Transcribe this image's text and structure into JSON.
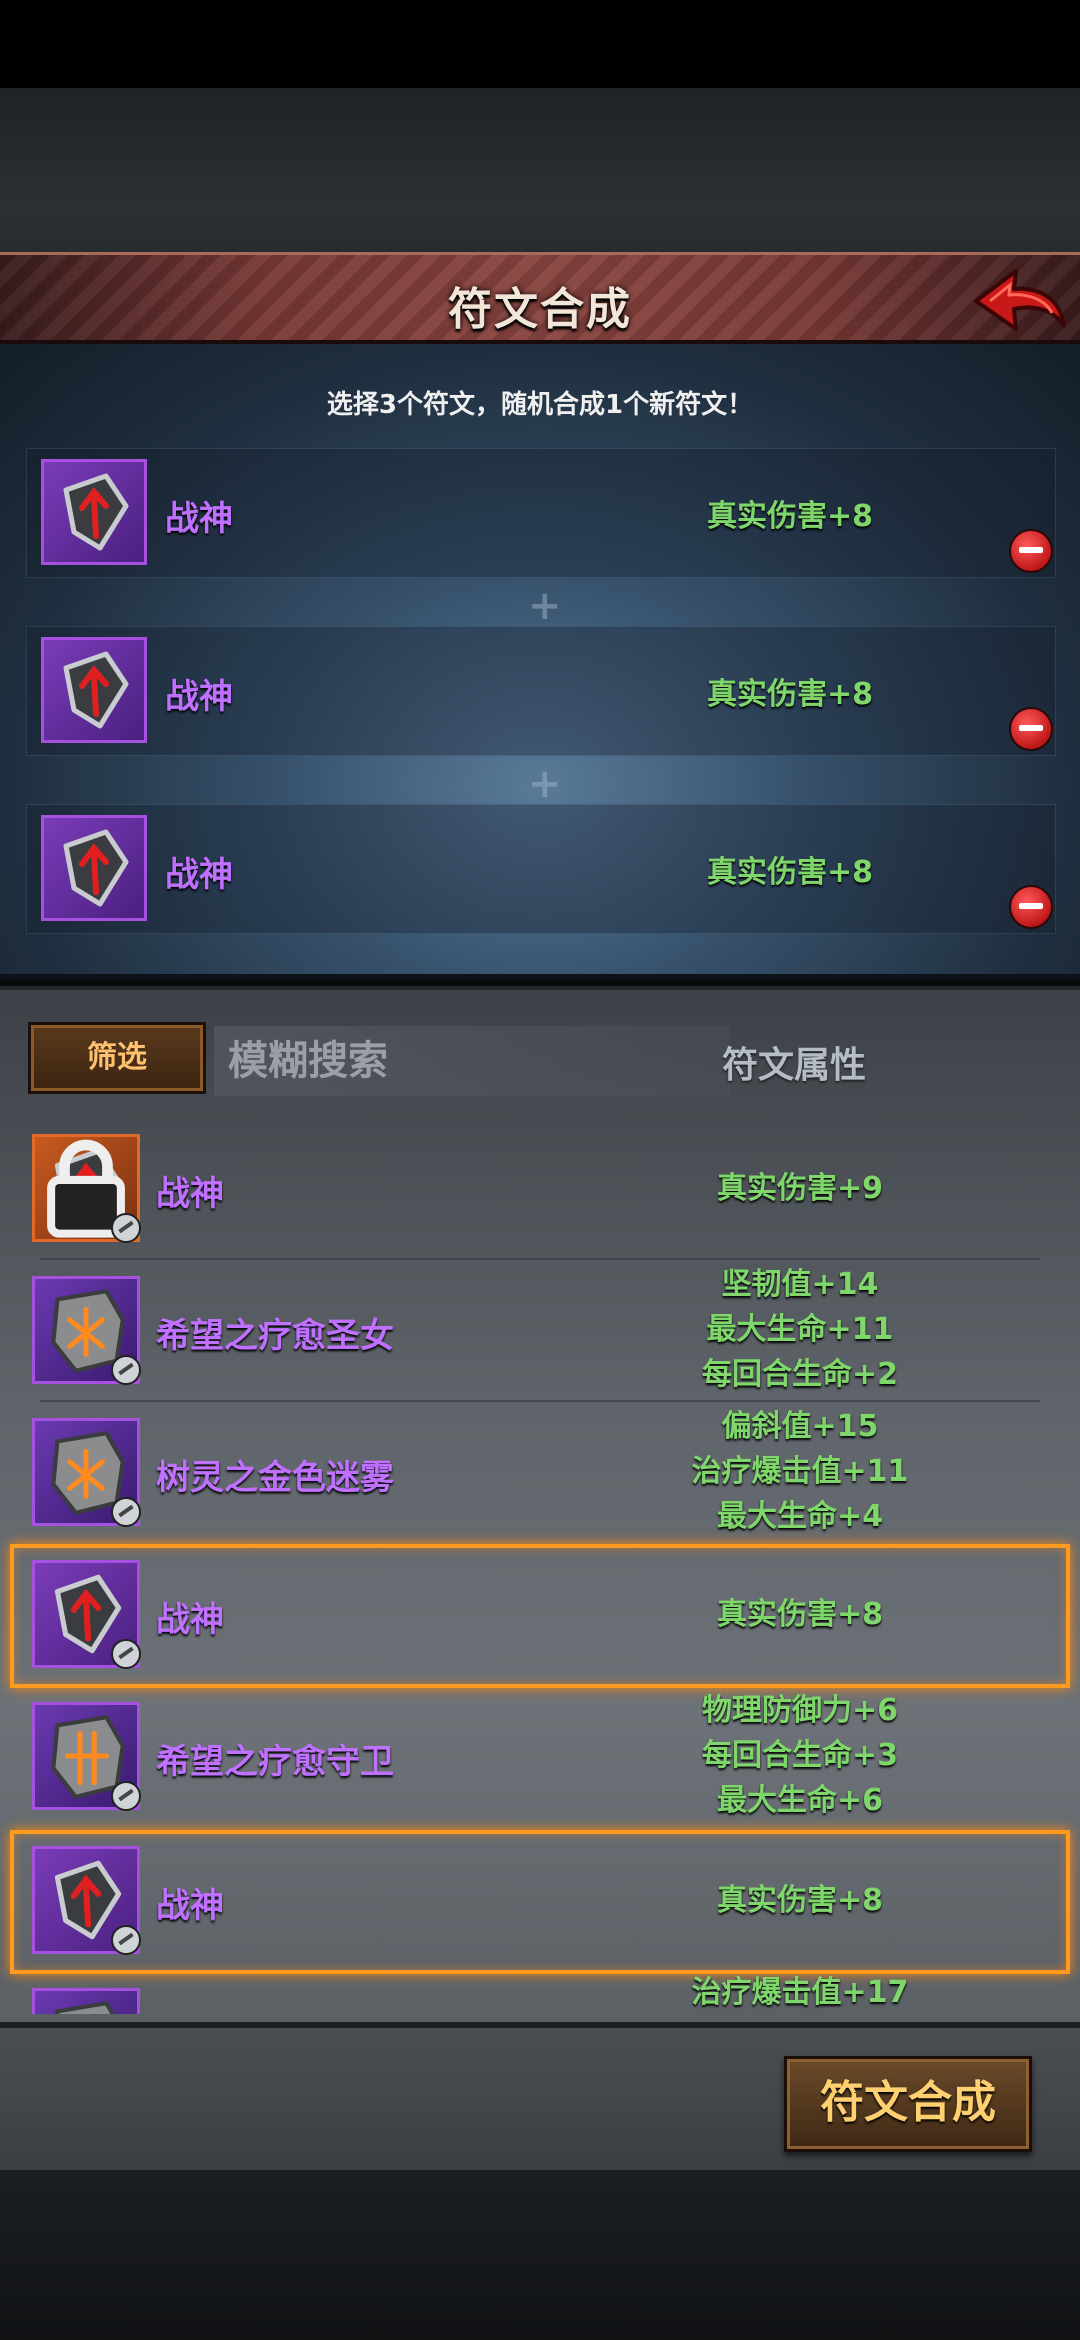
{
  "header": {
    "title": "符文合成"
  },
  "selection": {
    "instruction": "选择3个符文，随机合成1个新符文！",
    "slots": [
      {
        "name": "战神",
        "attr": "真实伤害+8"
      },
      {
        "name": "战神",
        "attr": "真实伤害+8"
      },
      {
        "name": "战神",
        "attr": "真实伤害+8"
      }
    ]
  },
  "filters": {
    "filter_label": "筛选",
    "search_placeholder": "模糊搜索",
    "attr_header": "符文属性"
  },
  "runes": [
    {
      "name": "战神",
      "attrs": [
        "真实伤害+9"
      ],
      "locked": true,
      "selected": false,
      "color": "orange"
    },
    {
      "name": "希望之疗愈圣女",
      "attrs": [
        "坚韧值+14",
        "最大生命+11",
        "每回合生命+2"
      ],
      "locked": false,
      "selected": false,
      "color": "purple"
    },
    {
      "name": "树灵之金色迷雾",
      "attrs": [
        "偏斜值+15",
        "治疗爆击值+11",
        "最大生命+4"
      ],
      "locked": false,
      "selected": false,
      "color": "purple"
    },
    {
      "name": "战神",
      "attrs": [
        "真实伤害+8"
      ],
      "locked": false,
      "selected": true,
      "color": "purple"
    },
    {
      "name": "希望之疗愈守卫",
      "attrs": [
        "物理防御力+6",
        "每回合生命+3",
        "最大生命+6"
      ],
      "locked": false,
      "selected": false,
      "color": "purple"
    },
    {
      "name": "战神",
      "attrs": [
        "真实伤害+8"
      ],
      "locked": false,
      "selected": true,
      "color": "purple"
    },
    {
      "name": "",
      "attrs": [
        "治疗爆击值+17"
      ],
      "locked": false,
      "selected": false,
      "color": "purple"
    }
  ],
  "footer": {
    "compose_label": "符文合成"
  },
  "colors": {
    "rune_name": "#c070ff",
    "attr_text": "#7fd66a",
    "highlight": "#ff9a20",
    "button_text": "#ffd070"
  }
}
